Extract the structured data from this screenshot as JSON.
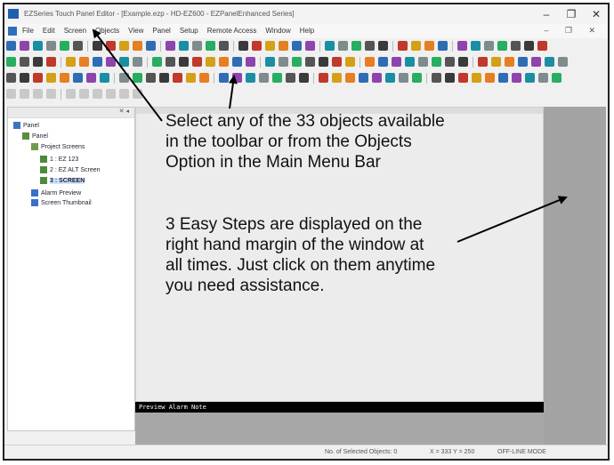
{
  "window": {
    "title": "EZSeries Touch Panel Editor - [Example.ezp - HD-EZ600 - EZPanelEnhanced Series]",
    "min": "–",
    "max": "❐",
    "close": "✕"
  },
  "menu": [
    "File",
    "Edit",
    "Screen",
    "Objects",
    "View",
    "Panel",
    "Setup",
    "Remote Access",
    "Window",
    "Help"
  ],
  "menu_controls": "– ❐ ✕",
  "tree": {
    "header": "✕ ◂",
    "nodes": [
      "Panel",
      "Panel",
      "Project Screens",
      "1 : EZ 123",
      "2 : EZ ALT Screen",
      "3 : SCREEN",
      "Alarm Preview",
      "Screen Thumbnail"
    ]
  },
  "preview_bar": "Preview Alarm Note",
  "status": {
    "selected": "No. of Selected Objects: 0",
    "coords": "X = 333 Y = 250",
    "mode": "OFF-LINE MODE"
  },
  "callout1": [
    "Select any of the 33 objects available",
    "in the toolbar or from the Objects",
    "Option in the Main Menu Bar"
  ],
  "callout2": [
    "3 Easy Steps are displayed on the",
    "right hand margin of the window at",
    "all times. Just click on them anytime",
    "you need assistance."
  ]
}
